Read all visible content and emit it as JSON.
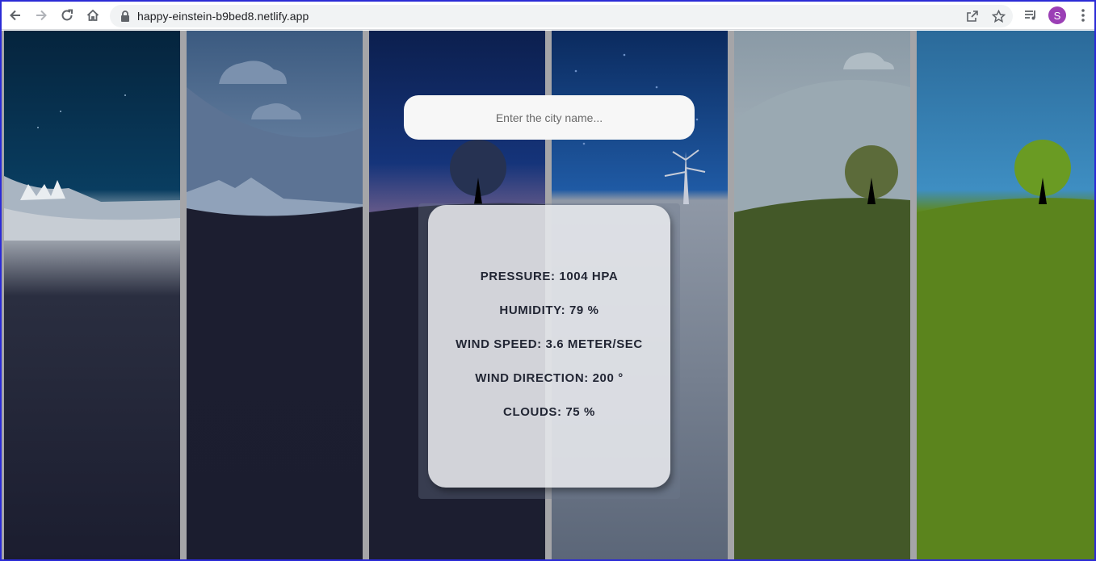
{
  "browser": {
    "url": "happy-einstein-b9bed8.netlify.app",
    "avatar_initial": "S",
    "icons": [
      "back-arrow-icon",
      "forward-arrow-icon",
      "reload-icon",
      "home-icon",
      "lock-icon",
      "open-in-app-icon",
      "star-icon",
      "media-queue-icon",
      "more-vert-icon"
    ]
  },
  "search": {
    "placeholder": "Enter the city name..."
  },
  "weather": {
    "pressure": "PRESSURE: 1004 HPA",
    "humidity": "HUMIDITY: 79 %",
    "wind_speed": "WIND SPEED: 3.6 METER/SEC",
    "wind_direction": "WIND DIRECTION: 200 °",
    "clouds": "CLOUDS: 75 %"
  },
  "colors": {
    "frame_border": "#2b2bd6",
    "divider": "#a5a5a8",
    "card_bg": "#ebecf0",
    "text_dark": "#222634",
    "avatar": "#9b3fb5"
  }
}
